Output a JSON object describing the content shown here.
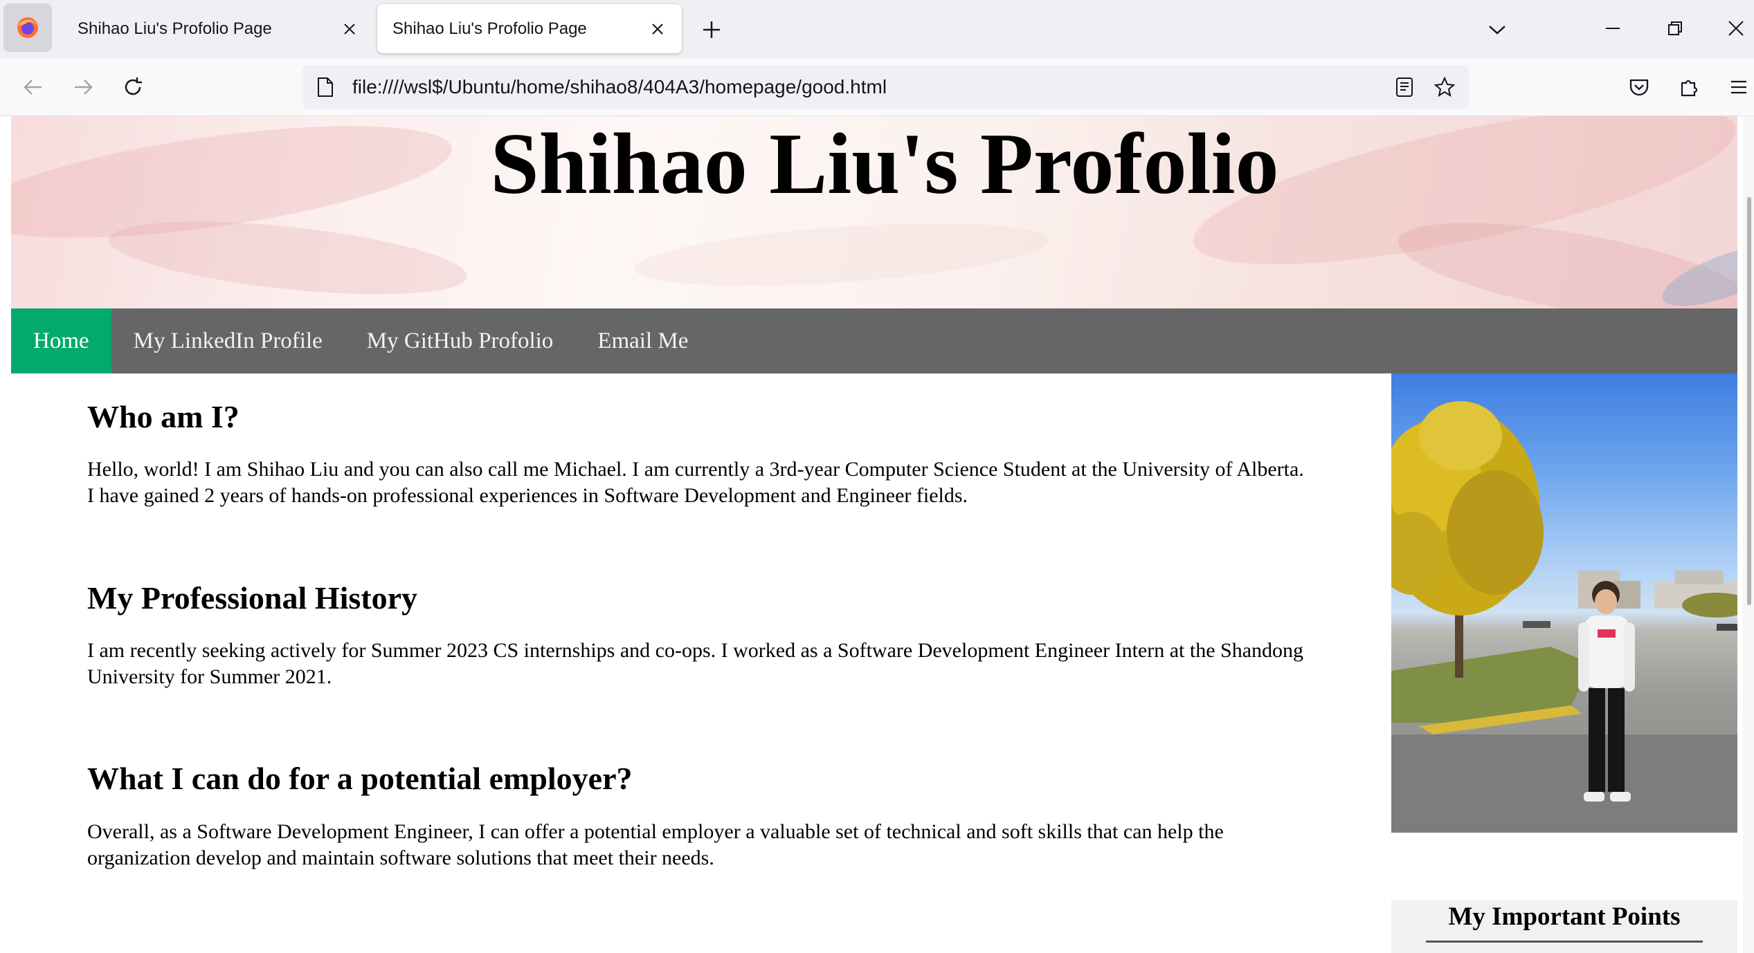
{
  "browser": {
    "tabs": [
      {
        "title": "Shihao Liu's Profolio Page",
        "active": false
      },
      {
        "title": "Shihao Liu's Profolio Page",
        "active": true
      }
    ],
    "url": "file:////wsl$/Ubuntu/home/shihao8/404A3/homepage/good.html",
    "icons": {
      "app_menu": "firefox-icon",
      "new_tab": "plus-icon",
      "tab_list": "chevron-down-icon",
      "back": "back-arrow-icon",
      "forward": "forward-arrow-icon",
      "reload": "reload-icon",
      "page": "page-icon",
      "reader": "reader-view-icon",
      "bookmark": "star-icon",
      "pocket": "pocket-icon",
      "extensions": "puzzle-icon",
      "menu": "hamburger-icon"
    }
  },
  "page": {
    "banner_title": "Shihao Liu's Profolio",
    "nav": [
      {
        "label": "Home",
        "active": true
      },
      {
        "label": "My LinkedIn Profile",
        "active": false
      },
      {
        "label": "My GitHub Profolio",
        "active": false
      },
      {
        "label": "Email Me",
        "active": false
      }
    ],
    "sections": [
      {
        "heading": "Who am I?",
        "body": "Hello, world! I am Shihao Liu and you can also call me Michael. I am currently a 3rd-year Computer Science Student at the University of Alberta. I have gained 2 years of hands-on professional experiences in Software Development and Engineer fields."
      },
      {
        "heading": "My Professional History",
        "body": "I am recently seeking actively for Summer 2023 CS internships and co-ops. I worked as a Software Development Engineer Intern at the Shandong University for Summer 2021."
      },
      {
        "heading": "What I can do for a potential employer?",
        "body": "Overall, as a Software Development Engineer, I can offer a potential employer a valuable set of technical and soft skills that can help the organization develop and maintain software solutions that meet their needs."
      }
    ],
    "sidebar_heading": "My Important Points",
    "colors": {
      "nav_bg": "#666666",
      "nav_active": "#04aa6d",
      "nav_text": "#f2f2f2",
      "sidebar_bg": "#f1f1f1"
    }
  }
}
